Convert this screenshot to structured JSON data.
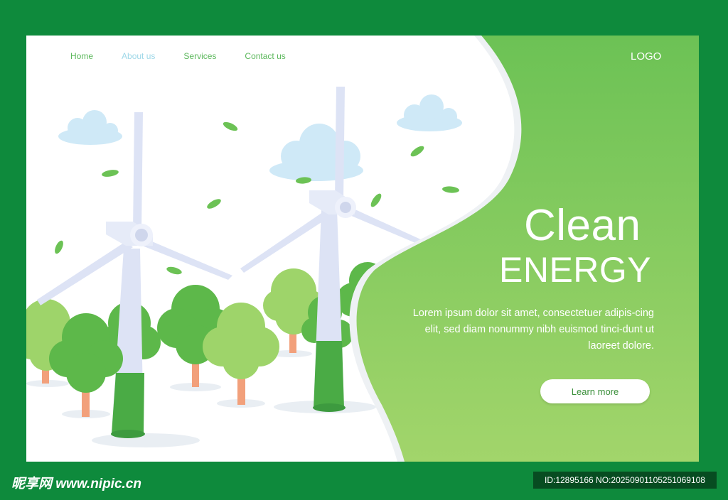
{
  "nav": {
    "items": [
      {
        "label": "Home"
      },
      {
        "label": "About us"
      },
      {
        "label": "Services"
      },
      {
        "label": "Contact us"
      }
    ]
  },
  "logo": "LOGO",
  "hero": {
    "title": "Clean",
    "subtitle": "ENERGY",
    "description": "Lorem ipsum dolor sit amet, consectetuer adipis-cing elit, sed diam nonummy nibh euismod tinci-dunt ut laoreet dolore.",
    "cta_label": "Learn more"
  },
  "watermark": {
    "site": "昵享网 www.nipic.cn",
    "id": "ID:12895166 NO:20250901105251069108"
  },
  "colors": {
    "frame": "#0e8a3c",
    "panel": "#6cc255",
    "tree_dark": "#5db84a",
    "tree_light": "#9ed46a",
    "turbine": "#dde3f5",
    "cloud": "#cfe9f7"
  },
  "icons": [
    "cloud-icon",
    "leaf-icon",
    "wind-turbine-icon",
    "tree-icon"
  ]
}
